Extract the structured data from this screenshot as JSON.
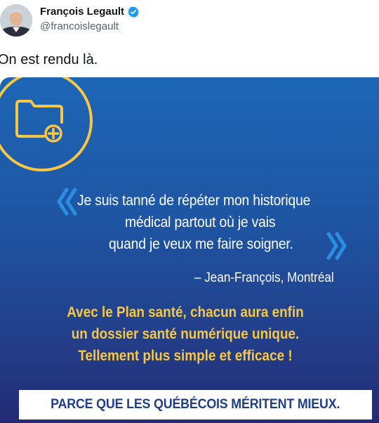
{
  "author": {
    "name": "François Legault",
    "handle": "@francoislegault",
    "verified_icon": "verified-badge-icon",
    "verified_color": "#1d9bf0"
  },
  "tweet": {
    "text": "On est rendu là."
  },
  "media": {
    "icon": "folder-plus-icon",
    "accent_color": "#f6c744",
    "background_top": "#1d66b6",
    "background_bottom": "#232b74",
    "quote_lines": [
      "Je suis tanné de répéter mon historique",
      "médical partout où je vais",
      "quand je veux me faire soigner."
    ],
    "attribution": "– Jean-François, Montréal",
    "highlight_lines": [
      "Avec le Plan santé, chacun aura enfin",
      "un dossier santé numérique unique.",
      "Tellement plus simple et efficace !"
    ],
    "banner": "PARCE QUE LES QUÉBÉCOIS MÉRITENT MIEUX."
  }
}
